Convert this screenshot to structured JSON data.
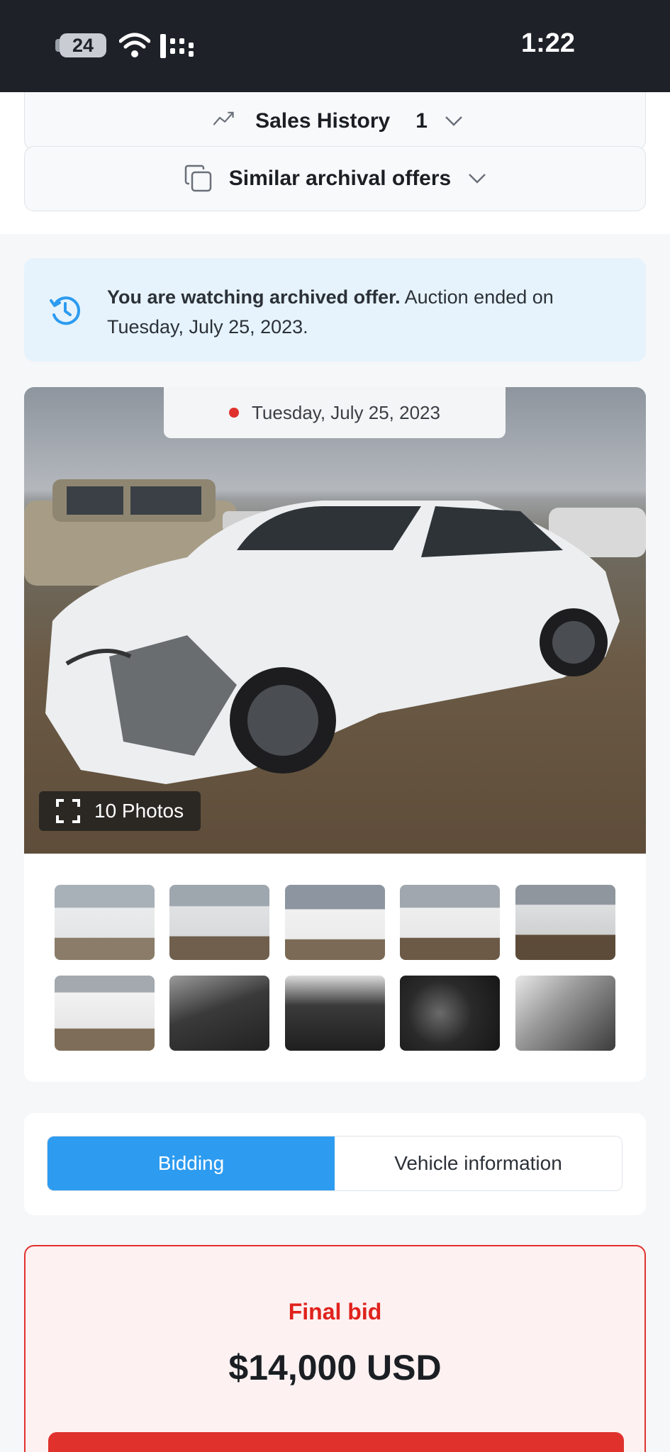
{
  "status_bar": {
    "battery": "24",
    "time": "1:22"
  },
  "sections": {
    "sales_history": {
      "label": "Sales History",
      "count": "1"
    },
    "similar_offers": {
      "label": "Similar archival offers"
    }
  },
  "notice": {
    "bold": "You are watching archived offer.",
    "text": " Auction ended on Tuesday, July 25, 2023."
  },
  "gallery": {
    "date": "Tuesday, July 25, 2023",
    "photos_label": "10 Photos",
    "thumb_count": 10
  },
  "tabs": [
    {
      "label": "Bidding",
      "active": true
    },
    {
      "label": "Vehicle information",
      "active": false
    }
  ],
  "final_bid": {
    "label": "Final bid",
    "value": "$14,000 USD"
  },
  "colors": {
    "accent_blue": "#2d9bf0",
    "alert_red": "#e0312d",
    "notice_bg": "#e6f3fc",
    "status_bar_bg": "#1e2128"
  }
}
